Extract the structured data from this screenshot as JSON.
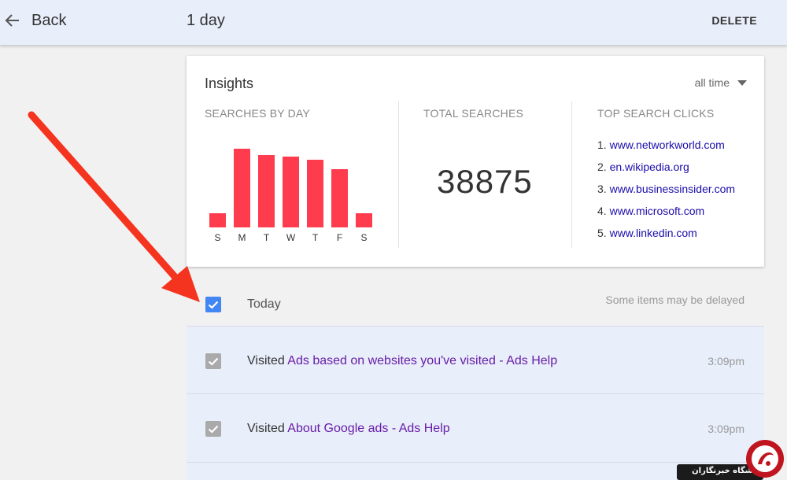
{
  "header": {
    "back_label": "Back",
    "title": "1 day",
    "delete_label": "DELETE"
  },
  "insights": {
    "title": "Insights",
    "range": "all time",
    "searches_by_day_label": "SEARCHES BY DAY",
    "total_searches_label": "TOTAL SEARCHES",
    "total_searches_value": "38875",
    "top_clicks_label": "TOP SEARCH CLICKS",
    "top_clicks": [
      {
        "rank": "1.",
        "site": "www.networkworld.com"
      },
      {
        "rank": "2.",
        "site": "en.wikipedia.org"
      },
      {
        "rank": "3.",
        "site": "www.businessinsider.com"
      },
      {
        "rank": "4.",
        "site": "www.microsoft.com"
      },
      {
        "rank": "5.",
        "site": "www.linkedin.com"
      }
    ]
  },
  "chart_data": {
    "type": "bar",
    "title": "SEARCHES BY DAY",
    "categories": [
      "S",
      "M",
      "T",
      "W",
      "T",
      "F",
      "S"
    ],
    "values": [
      18,
      100,
      92,
      90,
      86,
      74,
      18
    ],
    "ylim": [
      0,
      100
    ],
    "bar_color": "#ff3c4d",
    "grid": false
  },
  "day_section": {
    "label": "Today",
    "note": "Some items may be delayed",
    "checked": true
  },
  "history": [
    {
      "prefix": "Visited ",
      "link": "Ads based on websites you've visited - Ads Help",
      "time": "3:09pm"
    },
    {
      "prefix": "Visited ",
      "link": "About Google ads - Ads Help",
      "time": "3:09pm"
    }
  ],
  "watermark": {
    "text": "باشگاه خبرنگاران"
  },
  "colors": {
    "accent_blue": "#4285f4",
    "header_bg": "#e8eefa",
    "link_blue": "#1a0dab",
    "visited_purple": "#681da8",
    "annotation_red": "#f5341f"
  }
}
